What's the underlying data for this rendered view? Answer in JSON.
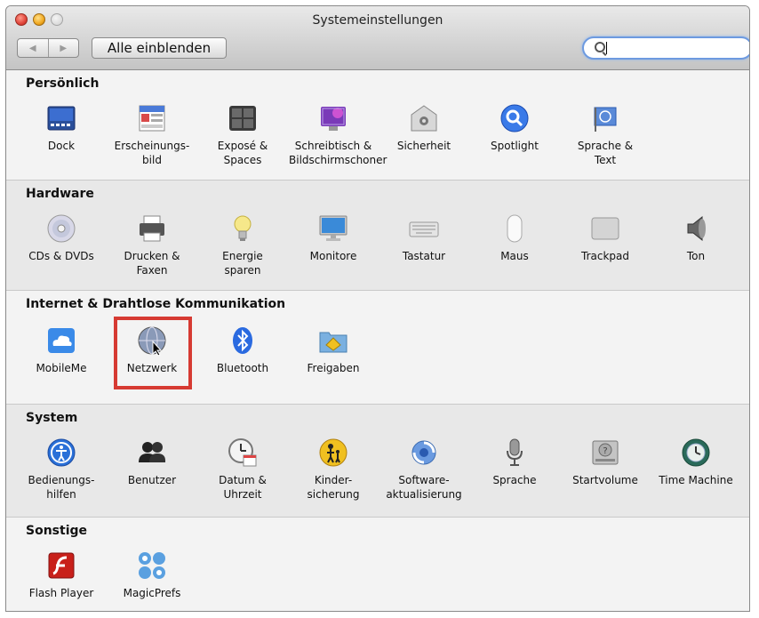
{
  "window": {
    "title": "Systemeinstellungen"
  },
  "toolbar": {
    "back_label": "◀",
    "forward_label": "▶",
    "show_all_label": "Alle einblenden",
    "search_value": ""
  },
  "sections": [
    {
      "title": "Persönlich",
      "items": [
        {
          "label": "Dock",
          "icon": "dock-icon"
        },
        {
          "label": "Erscheinungs-\nbild",
          "icon": "appearance-icon"
        },
        {
          "label": "Exposé &\nSpaces",
          "icon": "expose-icon"
        },
        {
          "label": "Schreibtisch &\nBildschirmschoner",
          "icon": "desktop-icon"
        },
        {
          "label": "Sicherheit",
          "icon": "security-icon"
        },
        {
          "label": "Spotlight",
          "icon": "spotlight-icon"
        },
        {
          "label": "Sprache &\nText",
          "icon": "language-icon"
        }
      ]
    },
    {
      "title": "Hardware",
      "items": [
        {
          "label": "CDs & DVDs",
          "icon": "cd-icon"
        },
        {
          "label": "Drucken &\nFaxen",
          "icon": "printer-icon"
        },
        {
          "label": "Energie\nsparen",
          "icon": "bulb-icon"
        },
        {
          "label": "Monitore",
          "icon": "monitor-icon"
        },
        {
          "label": "Tastatur",
          "icon": "keyboard-icon"
        },
        {
          "label": "Maus",
          "icon": "mouse-icon"
        },
        {
          "label": "Trackpad",
          "icon": "trackpad-icon"
        },
        {
          "label": "Ton",
          "icon": "speaker-icon"
        }
      ]
    },
    {
      "title": "Internet & Drahtlose Kommunikation",
      "items": [
        {
          "label": "MobileMe",
          "icon": "cloud-icon"
        },
        {
          "label": "Netzwerk",
          "icon": "globe-icon"
        },
        {
          "label": "Bluetooth",
          "icon": "bluetooth-icon"
        },
        {
          "label": "Freigaben",
          "icon": "folder-icon"
        }
      ]
    },
    {
      "title": "System",
      "items": [
        {
          "label": "Bedienungs-\nhilfen",
          "icon": "accessibility-icon"
        },
        {
          "label": "Benutzer",
          "icon": "users-icon"
        },
        {
          "label": "Datum &\nUhrzeit",
          "icon": "clock-icon"
        },
        {
          "label": "Kinder-\nsicherung",
          "icon": "parental-icon"
        },
        {
          "label": "Software-\naktualisierung",
          "icon": "update-icon"
        },
        {
          "label": "Sprache",
          "icon": "microphone-icon"
        },
        {
          "label": "Startvolume",
          "icon": "harddisk-icon"
        },
        {
          "label": "Time Machine",
          "icon": "timemachine-icon"
        }
      ]
    },
    {
      "title": "Sonstige",
      "items": [
        {
          "label": "Flash Player",
          "icon": "flash-icon"
        },
        {
          "label": "MagicPrefs",
          "icon": "magicprefs-icon"
        }
      ]
    }
  ],
  "colors": {
    "highlight": "#d63a32",
    "search_focus": "#6d9ae0"
  }
}
